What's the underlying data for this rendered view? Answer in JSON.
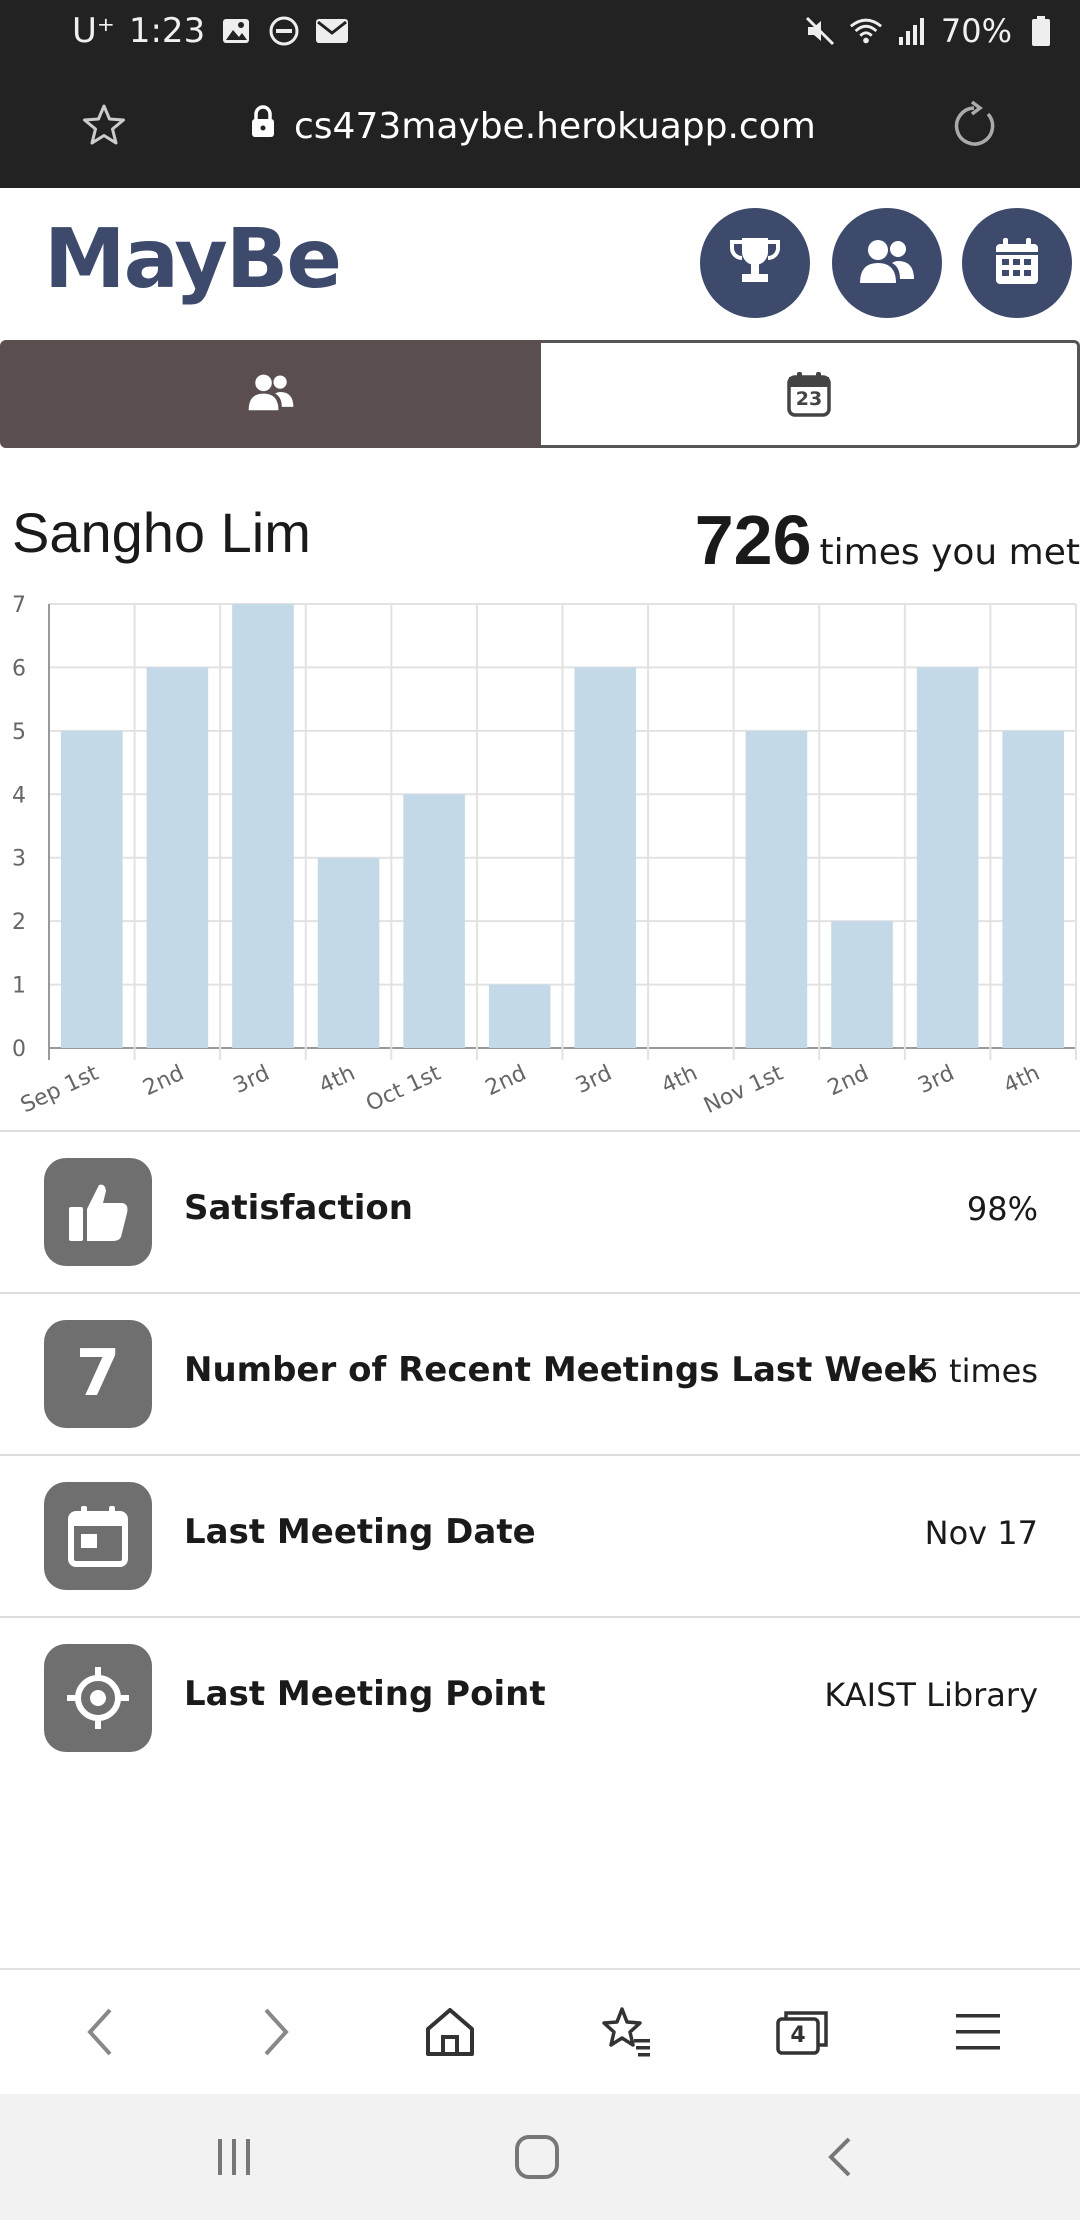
{
  "status_bar": {
    "carrier": "U⁺",
    "time": "1:23",
    "battery": "70%"
  },
  "browser": {
    "url": "cs473maybe.herokuapp.com",
    "tab_count": "4"
  },
  "app": {
    "logo": "MayBe",
    "header_buttons": [
      "trophy-icon",
      "people-icon",
      "calendar-icon"
    ],
    "tabs": [
      {
        "icon": "people-icon",
        "active": true
      },
      {
        "icon": "calendar-day-icon",
        "day": "23",
        "active": false
      }
    ]
  },
  "person": {
    "name": "Sangho Lim",
    "times_met": "726",
    "times_met_label": "times you met"
  },
  "chart_data": {
    "type": "bar",
    "categories": [
      "Sep 1st",
      "2nd",
      "3rd",
      "4th",
      "Oct 1st",
      "2nd",
      "3rd",
      "4th",
      "Nov 1st",
      "2nd",
      "3rd",
      "4th"
    ],
    "values": [
      5,
      6,
      7,
      3,
      4,
      1,
      6,
      0,
      5,
      2,
      6,
      5
    ],
    "yticks": [
      "0",
      "1",
      "2",
      "3",
      "4",
      "5",
      "6",
      "7"
    ],
    "ylim": [
      0,
      7
    ],
    "grid": true,
    "bar_color": "#c4d9e8"
  },
  "stats": [
    {
      "icon": "thumbs-up-icon",
      "label": "Satisfaction",
      "value": "98%"
    },
    {
      "icon": "seven-icon",
      "icon_text": "7",
      "label": "Number of Recent Meetings Last Week",
      "value": "5 times"
    },
    {
      "icon": "calendar-icon",
      "label": "Last Meeting Date",
      "value": "Nov 17"
    },
    {
      "icon": "location-target-icon",
      "label": "Last Meeting Point",
      "value": "KAIST Library"
    }
  ],
  "colors": {
    "brand": "#3d4a6b",
    "active_tab": "#5a4e4f",
    "stat_icon_bg": "#6f6f6f"
  }
}
